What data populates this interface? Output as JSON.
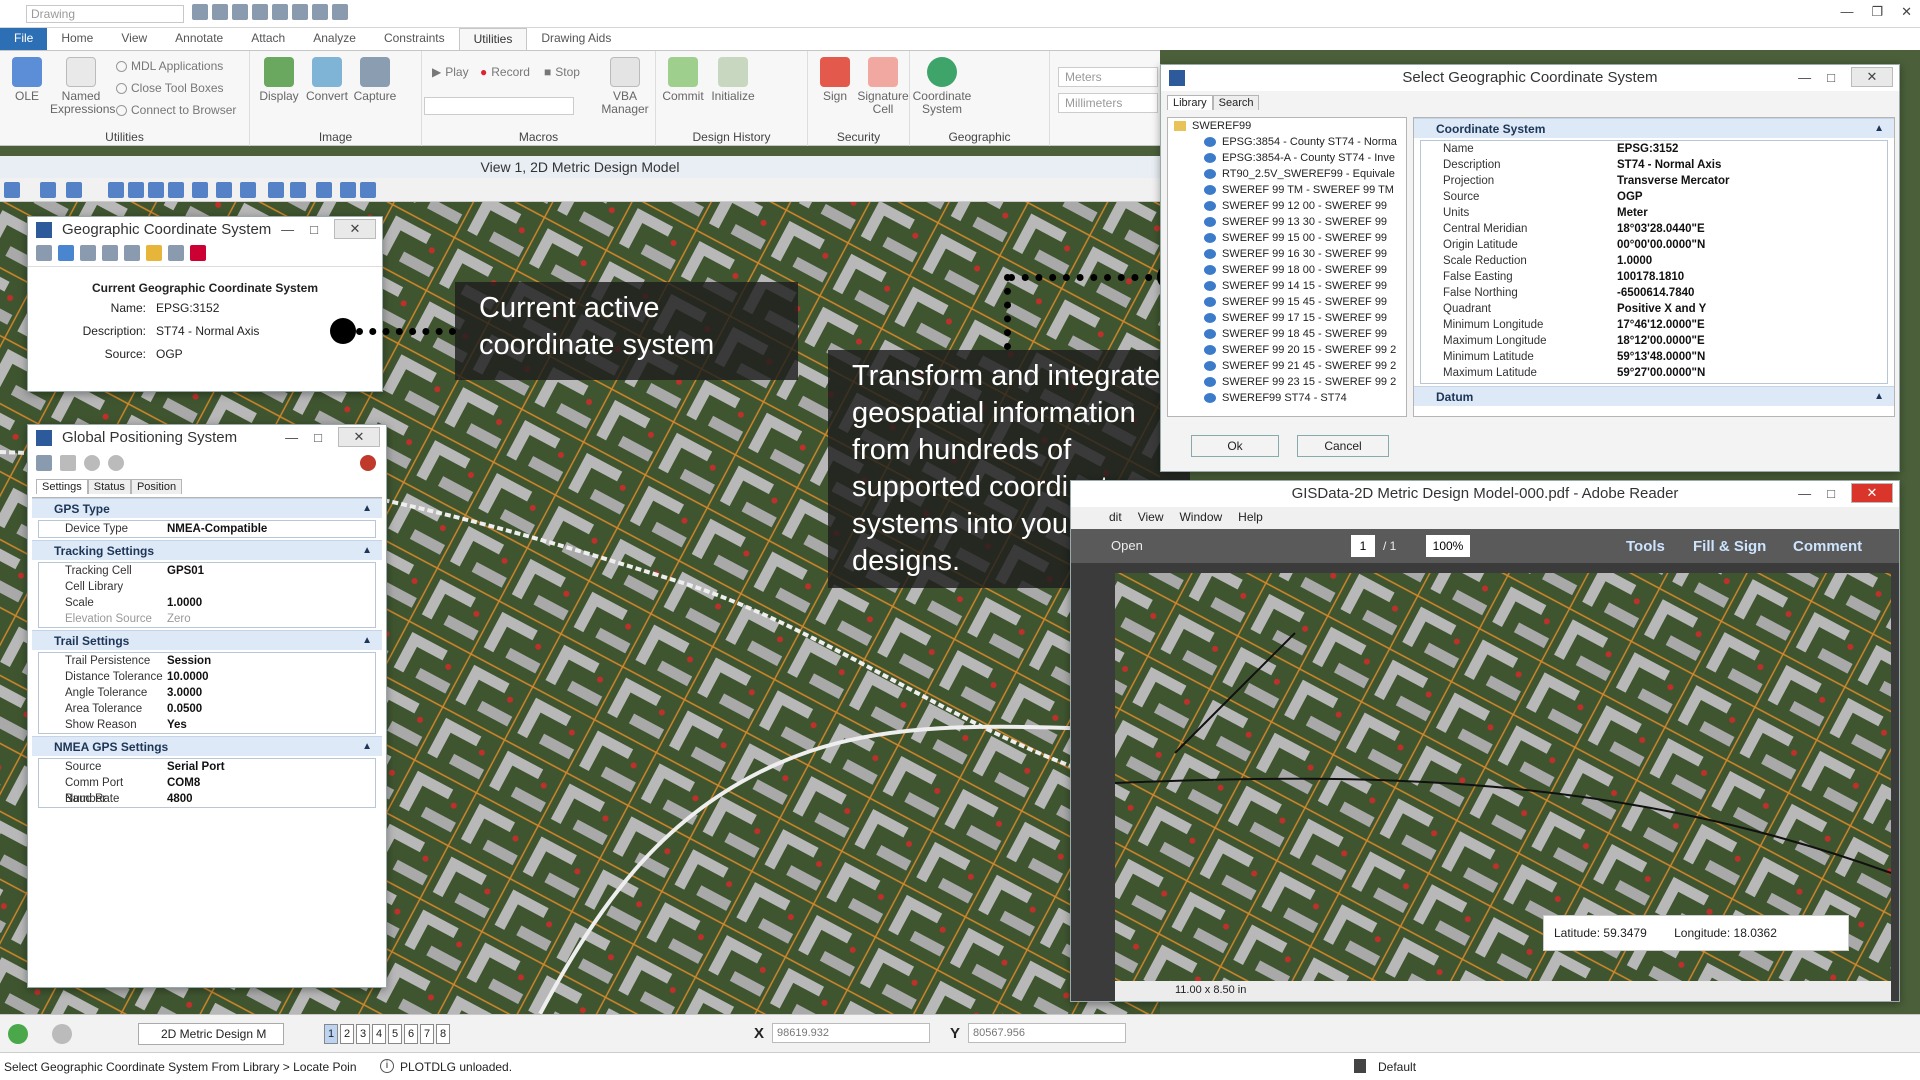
{
  "qat": {
    "workflow": "Drawing"
  },
  "tabs": [
    "File",
    "Home",
    "View",
    "Annotate",
    "Attach",
    "Analyze",
    "Constraints",
    "Utilities",
    "Drawing Aids"
  ],
  "ribbon": {
    "utilities": {
      "label": "Utilities",
      "ole": "OLE",
      "named": "Named Expressions",
      "mdl": "MDL Applications",
      "close": "Close Tool Boxes",
      "connect": "Connect to Browser"
    },
    "image": {
      "label": "Image",
      "display": "Display",
      "convert": "Convert",
      "capture": "Capture"
    },
    "macros": {
      "label": "Macros",
      "play": "Play",
      "record": "Record",
      "stop": "Stop",
      "vba": "VBA Manager"
    },
    "design_history": {
      "label": "Design History",
      "commit": "Commit",
      "initialize": "Initialize"
    },
    "security": {
      "label": "Security",
      "sign": "Sign",
      "signature_cell": "Signature Cell"
    },
    "geographic": {
      "label": "Geographic",
      "coord": "Coordinate System"
    },
    "units": [
      "Meters",
      "Millimeters"
    ]
  },
  "view_title": "View 1, 2D Metric Design Model",
  "gcs_window": {
    "title": "Geographic Coordinate System",
    "heading": "Current Geographic Coordinate System",
    "rows": [
      {
        "k": "Name:",
        "v": "EPSG:3152"
      },
      {
        "k": "Description:",
        "v": "ST74 - Normal Axis"
      },
      {
        "k": "Source:",
        "v": "OGP"
      }
    ]
  },
  "gps_window": {
    "title": "Global Positioning System",
    "tabs": [
      "Settings",
      "Status",
      "Position"
    ],
    "sections": [
      {
        "title": "GPS Type",
        "rows": [
          {
            "k": "Device Type",
            "v": "NMEA-Compatible"
          }
        ]
      },
      {
        "title": "Tracking Settings",
        "rows": [
          {
            "k": "Tracking Cell",
            "v": "GPS01"
          },
          {
            "k": "Cell Library",
            "v": ""
          },
          {
            "k": "Scale",
            "v": "1.0000"
          },
          {
            "k": "Elevation Source",
            "v": "Zero"
          }
        ]
      },
      {
        "title": "Trail Settings",
        "rows": [
          {
            "k": "Trail Persistence",
            "v": "Session"
          },
          {
            "k": "Distance Tolerance",
            "v": "10.0000"
          },
          {
            "k": "Angle Tolerance",
            "v": "3.0000"
          },
          {
            "k": "Area Tolerance",
            "v": "0.0500"
          },
          {
            "k": "Show Reason",
            "v": "Yes"
          }
        ]
      },
      {
        "title": "NMEA GPS Settings",
        "rows": [
          {
            "k": "Source",
            "v": "Serial Port"
          },
          {
            "k": "Comm Port Number",
            "v": "COM8"
          },
          {
            "k": "Baud Rate",
            "v": "4800"
          }
        ]
      }
    ]
  },
  "select_gcs": {
    "title": "Select Geographic Coordinate System",
    "tabs": [
      "Library",
      "Search"
    ],
    "root": "SWEREF99",
    "items": [
      "EPSG:3854 - County ST74 - Norma",
      "EPSG:3854-A - County ST74 - Inve",
      "RT90_2.5V_SWEREF99 - Equivale",
      "SWEREF 99 TM - SWEREF 99 TM",
      "SWEREF 99 12 00 - SWEREF 99",
      "SWEREF 99 13 30 - SWEREF 99",
      "SWEREF 99 15 00 - SWEREF 99",
      "SWEREF 99 16 30 - SWEREF 99",
      "SWEREF 99 18 00 - SWEREF 99",
      "SWEREF 99 14 15 - SWEREF 99",
      "SWEREF 99 15 45 - SWEREF 99",
      "SWEREF 99 17 15 - SWEREF 99",
      "SWEREF 99 18 45 - SWEREF 99",
      "SWEREF 99 20 15 - SWEREF 99 2",
      "SWEREF 99 21 45 - SWEREF 99 2",
      "SWEREF 99 23 15 - SWEREF 99 2",
      "SWEREF99 ST74 - ST74"
    ],
    "section": "Coordinate System",
    "section2": "Datum",
    "props": [
      {
        "k": "Name",
        "v": "EPSG:3152"
      },
      {
        "k": "Description",
        "v": "ST74 - Normal Axis"
      },
      {
        "k": "Projection",
        "v": "Transverse Mercator"
      },
      {
        "k": "Source",
        "v": "OGP"
      },
      {
        "k": "Units",
        "v": "Meter"
      },
      {
        "k": "Central Meridian",
        "v": "18°03'28.0440\"E"
      },
      {
        "k": "Origin Latitude",
        "v": "00°00'00.0000\"N"
      },
      {
        "k": "Scale Reduction",
        "v": "1.0000"
      },
      {
        "k": "False Easting",
        "v": "100178.1810"
      },
      {
        "k": "False Northing",
        "v": "-6500614.7840"
      },
      {
        "k": "Quadrant",
        "v": "Positive X and Y"
      },
      {
        "k": "Minimum Longitude",
        "v": "17°46'12.0000\"E"
      },
      {
        "k": "Maximum Longitude",
        "v": "18°12'00.0000\"E"
      },
      {
        "k": "Minimum Latitude",
        "v": "59°13'48.0000\"N"
      },
      {
        "k": "Maximum Latitude",
        "v": "59°27'00.0000\"N"
      }
    ],
    "ok": "Ok",
    "cancel": "Cancel"
  },
  "pdf": {
    "title": "GISData-2D Metric Design Model-000.pdf - Adobe Reader",
    "menu": [
      "dit",
      "View",
      "Window",
      "Help"
    ],
    "open": "Open",
    "page": "1",
    "pages": "/ 1",
    "zoom": "100%",
    "tools": "Tools",
    "fill": "Fill & Sign",
    "comment": "Comment",
    "size": "11.00 x 8.50 in",
    "lat_label": "Latitude:",
    "lat": "59.3479",
    "lon_label": "Longitude:",
    "lon": "18.0362"
  },
  "callouts": {
    "one": "Current active coordinate system",
    "two": "Transform and integrate geospatial information from hundreds of supported coordinate systems into your designs."
  },
  "bottombar": {
    "model": "2D Metric Design M",
    "views": [
      "1",
      "2",
      "3",
      "4",
      "5",
      "6",
      "7",
      "8"
    ],
    "x_label": "X",
    "x": "98619.932",
    "y_label": "Y",
    "y": "80567.956"
  },
  "status": {
    "prompt": "Select Geographic Coordinate System From Library > Locate Poin",
    "message": "PLOTDLG unloaded.",
    "level": "Default"
  }
}
